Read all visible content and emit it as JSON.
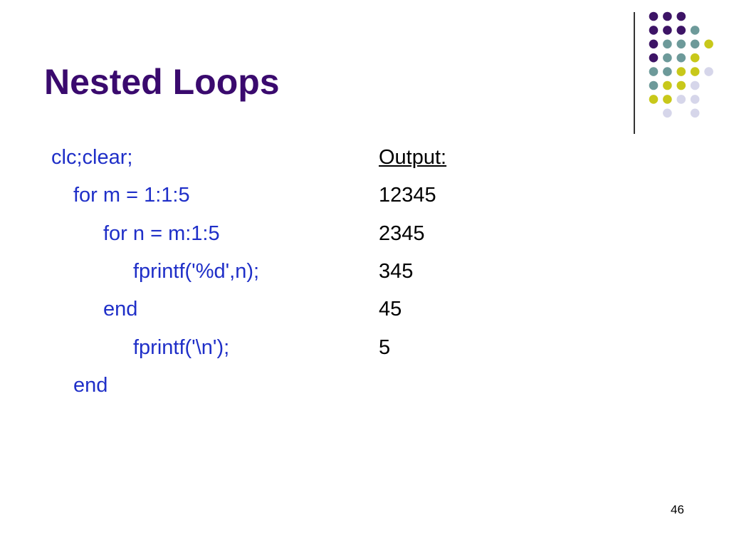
{
  "slide": {
    "title": "Nested Loops",
    "code_lines": [
      "clc;clear;",
      "for m = 1:1:5",
      "for n = m:1:5",
      "fprintf('%d',n);",
      "end",
      "fprintf('\\n');",
      "end"
    ],
    "output_heading": "Output:",
    "output_lines": [
      "12345",
      "2345",
      "345",
      "45",
      "5"
    ],
    "page_number": "46"
  },
  "colors": {
    "title": "#3a0a6e",
    "code": "#1f2fc8",
    "output": "#000000",
    "dot_purple": "#3d1466",
    "dot_teal": "#6d9a9a",
    "dot_yellow": "#c8c81a",
    "dot_lavender": "#d6d6ea"
  },
  "decoration": {
    "dot_grid": [
      [
        "purple",
        "purple",
        "purple",
        "",
        "",
        ""
      ],
      [
        "purple",
        "purple",
        "purple",
        "teal",
        "",
        ""
      ],
      [
        "purple",
        "teal",
        "teal",
        "teal",
        "yellow",
        ""
      ],
      [
        "purple",
        "teal",
        "teal",
        "yellow",
        "",
        ""
      ],
      [
        "teal",
        "teal",
        "yellow",
        "yellow",
        "lavender",
        ""
      ],
      [
        "teal",
        "yellow",
        "yellow",
        "lavender",
        "",
        ""
      ],
      [
        "yellow",
        "yellow",
        "lavender",
        "lavender",
        "",
        ""
      ],
      [
        "",
        "lavender",
        "",
        "lavender",
        "",
        ""
      ]
    ]
  }
}
